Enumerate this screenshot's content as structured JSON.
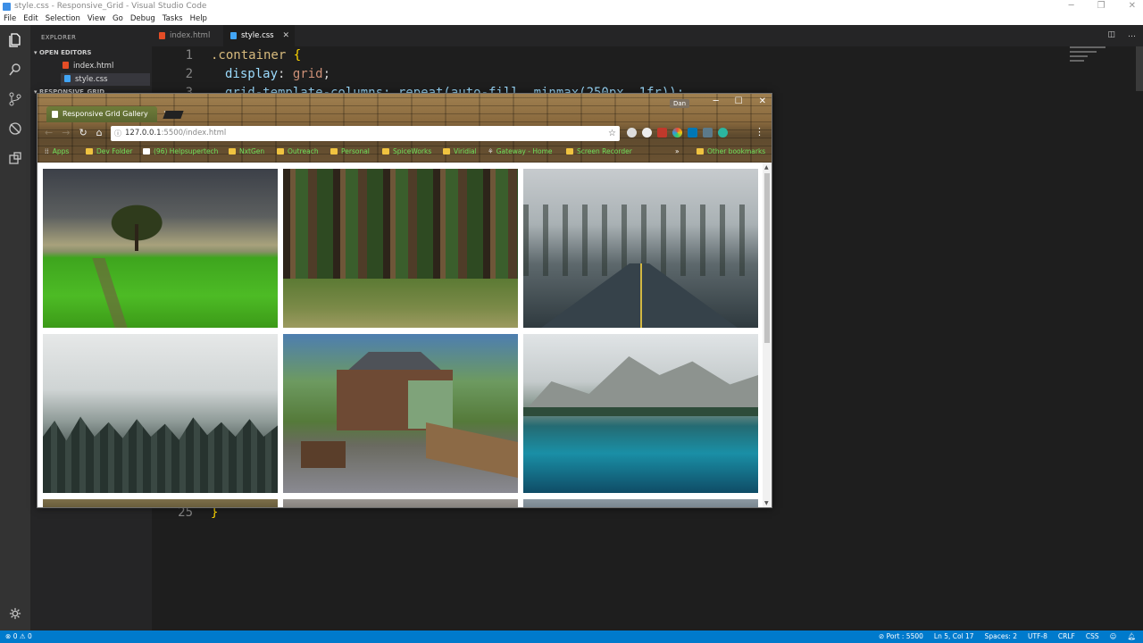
{
  "window": {
    "title": "style.css - Responsive_Grid - Visual Studio Code"
  },
  "menu": [
    "File",
    "Edit",
    "Selection",
    "View",
    "Go",
    "Debug",
    "Tasks",
    "Help"
  ],
  "sidebar": {
    "title": "EXPLORER",
    "open_editors": "OPEN EDITORS",
    "files": [
      {
        "name": "index.html",
        "type": "html"
      },
      {
        "name": "style.css",
        "type": "css"
      }
    ],
    "project": "RESPONSIVE_GRID"
  },
  "tabs": [
    {
      "label": "index.html",
      "type": "html",
      "active": false
    },
    {
      "label": "style.css",
      "type": "css",
      "active": true
    }
  ],
  "editor": {
    "lines": [
      {
        "num": "1",
        "selector": ".container",
        "brace": " {"
      },
      {
        "num": "2",
        "prop": "display",
        "value": "grid"
      },
      {
        "num": "3",
        "text": "grid-template-columns: repeat(auto-fill, minmax(250px, 1fr));"
      }
    ],
    "last_line": {
      "num": "25",
      "brace": "}"
    }
  },
  "statusbar": {
    "errors": "0",
    "warnings": "0",
    "port": "Port : 5500",
    "position": "Ln 5, Col 17",
    "spaces": "Spaces: 2",
    "encoding": "UTF-8",
    "eol": "CRLF",
    "language": "CSS"
  },
  "browser": {
    "tab_title": "Responsive Grid Gallery",
    "user": "Dan",
    "url_host": "127.0.0.1",
    "url_path": ":5500/index.html",
    "bookmarks": [
      "Apps",
      "Dev Folder",
      "(96) Helpsupertech",
      "NxtGen",
      "Outreach",
      "Personal",
      "SpiceWorks",
      "Viridial",
      "Gateway - Home",
      "Screen Recorder"
    ],
    "other_bookmarks": "Other bookmarks",
    "gallery": [
      {
        "name": "green-field-tree"
      },
      {
        "name": "forest"
      },
      {
        "name": "wet-road"
      },
      {
        "name": "foggy-forest"
      },
      {
        "name": "cabin"
      },
      {
        "name": "mountain-lake"
      }
    ]
  },
  "colors": {
    "activity_bar": "#333333",
    "sidebar": "#252526",
    "editor_bg": "#1e1e1e",
    "statusbar": "#007acc",
    "bookmark_text": "#6ee05a"
  }
}
